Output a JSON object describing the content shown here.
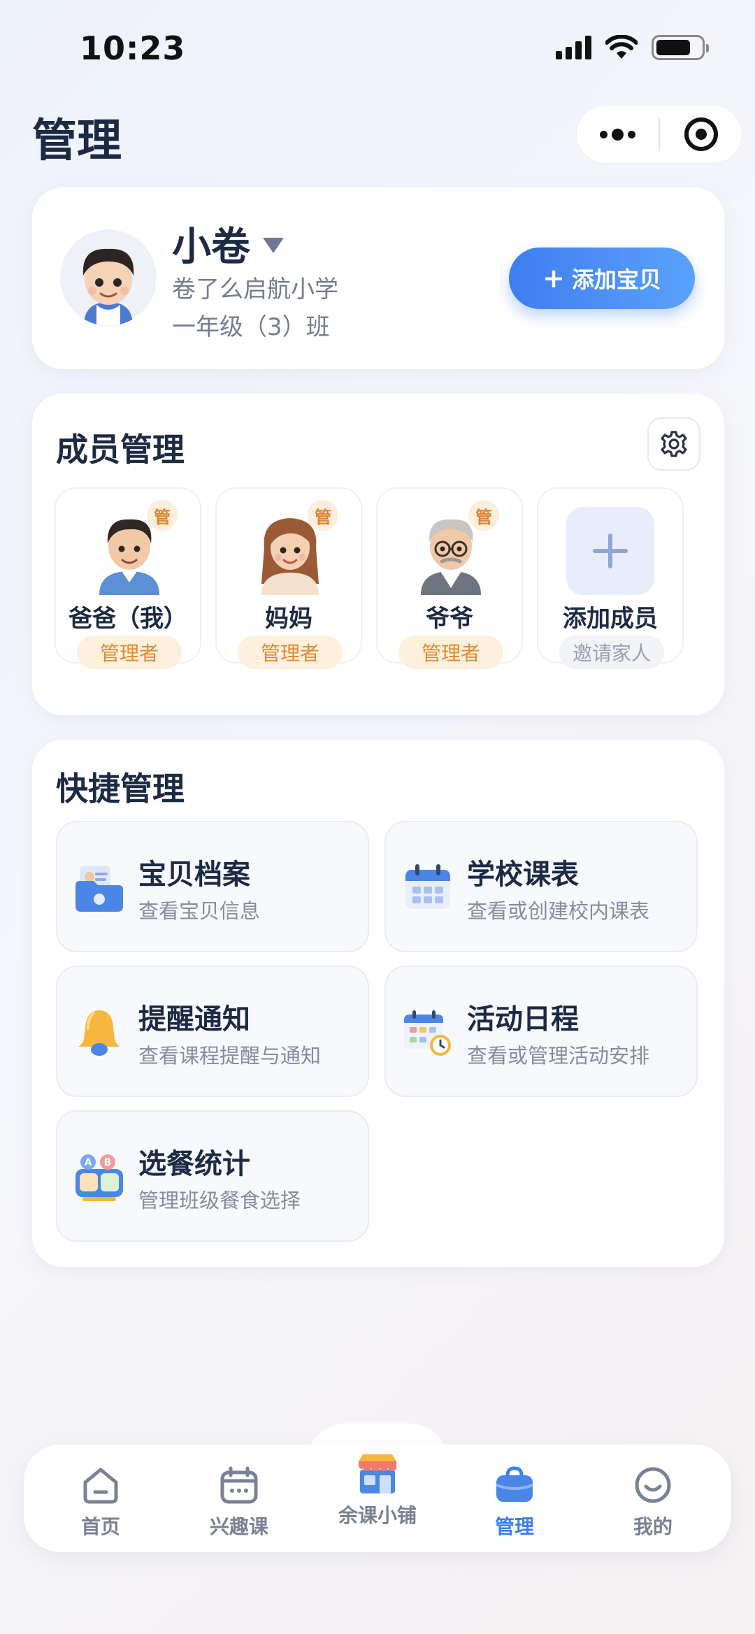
{
  "status_bar": {
    "time": "10:23"
  },
  "header": {
    "title": "管理"
  },
  "child": {
    "name": "小卷",
    "school": "卷了么启航小学",
    "class": "一年级（3）班",
    "add_button_label": "添加宝贝"
  },
  "members": {
    "title": "成员管理",
    "items": [
      {
        "name": "爸爸（我）",
        "role": "管理者",
        "badge": "管"
      },
      {
        "name": "妈妈",
        "role": "管理者",
        "badge": "管"
      },
      {
        "name": "爷爷",
        "role": "管理者",
        "badge": "管"
      }
    ],
    "add_member": {
      "name": "添加成员",
      "role": "邀请家人"
    }
  },
  "quick": {
    "title": "快捷管理",
    "items": [
      {
        "title": "宝贝档案",
        "desc": "查看宝贝信息",
        "icon": "profile-folder-icon"
      },
      {
        "title": "学校课表",
        "desc": "查看或创建校内课表",
        "icon": "calendar-icon"
      },
      {
        "title": "提醒通知",
        "desc": "查看课程提醒与通知",
        "icon": "bell-icon"
      },
      {
        "title": "活动日程",
        "desc": "查看或管理活动安排",
        "icon": "schedule-clock-icon"
      },
      {
        "title": "选餐统计",
        "desc": "管理班级餐食选择",
        "icon": "meal-box-icon"
      }
    ]
  },
  "tabs": [
    {
      "label": "首页",
      "icon": "home-icon",
      "active": false
    },
    {
      "label": "兴趣课",
      "icon": "calendar-icon",
      "active": false
    },
    {
      "label": "余课小铺",
      "icon": "shop-icon",
      "active": false
    },
    {
      "label": "管理",
      "icon": "bag-icon",
      "active": true
    },
    {
      "label": "我的",
      "icon": "smile-icon",
      "active": false
    }
  ],
  "colors": {
    "accent": "#3b7ef2",
    "role_badge": "#e28a32",
    "title": "#1c2a44"
  }
}
